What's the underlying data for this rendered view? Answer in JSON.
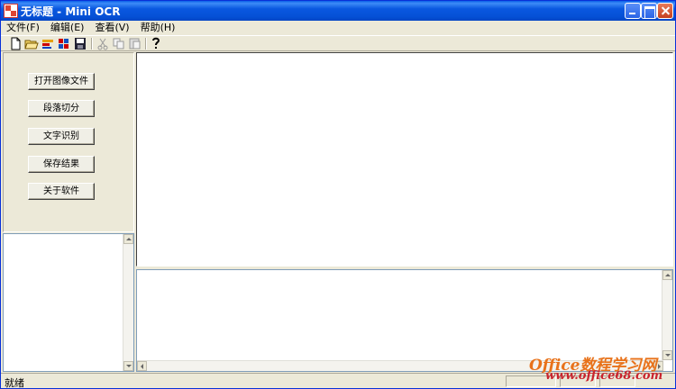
{
  "window": {
    "title": "无标题 - Mini OCR"
  },
  "menubar": {
    "items": [
      {
        "label": "文件(F)"
      },
      {
        "label": "编辑(E)"
      },
      {
        "label": "查看(V)"
      },
      {
        "label": "帮助(H)"
      }
    ]
  },
  "toolbar": {
    "icons": [
      "new-file-icon",
      "open-folder-icon",
      "color-icon",
      "grid-icon",
      "save-icon",
      "cut-icon",
      "copy-icon",
      "paste-icon",
      "help-icon"
    ]
  },
  "left_panel": {
    "buttons": [
      {
        "label": "打开图像文件"
      },
      {
        "label": "段落切分"
      },
      {
        "label": "文字识别"
      },
      {
        "label": "保存结果"
      },
      {
        "label": "关于软件"
      }
    ]
  },
  "statusbar": {
    "text": "就绪"
  },
  "watermark": {
    "line1": "Office数程学习网",
    "line2": "www.office68.com"
  },
  "colors": {
    "titlebar": "#0a58e0",
    "face": "#ece9d8",
    "watermark_orange": "#e8721a",
    "watermark_red": "#c9232d"
  }
}
